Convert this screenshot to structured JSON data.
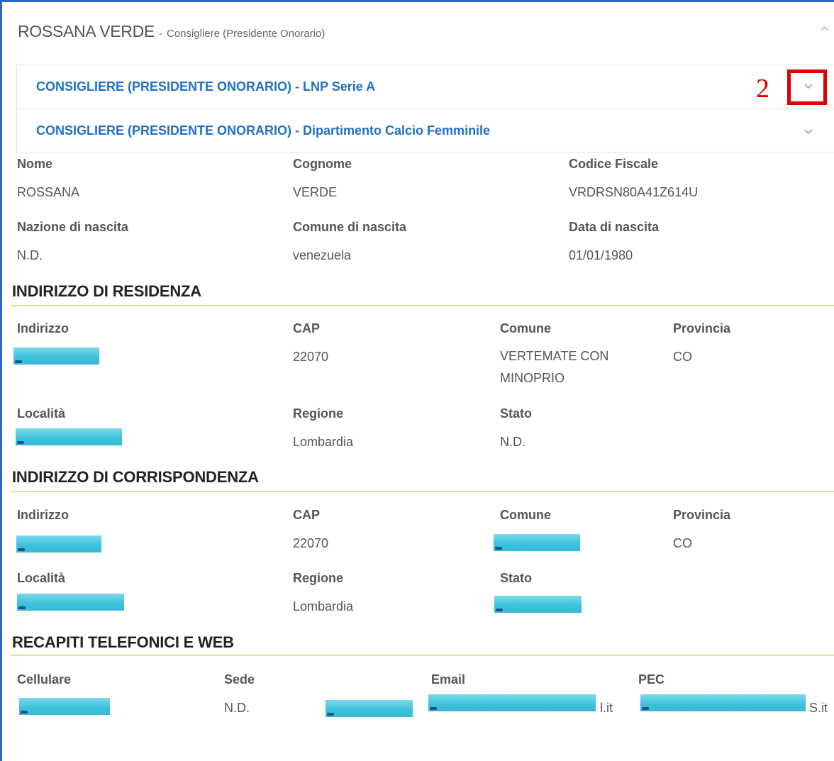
{
  "header": {
    "name": "ROSSANA VERDE",
    "separator": "-",
    "role": "Consigliere (Presidente Onorario)"
  },
  "accordion": [
    {
      "title": "CONSIGLIERE (PRESIDENTE ONORARIO) - LNP Serie A"
    },
    {
      "title": "CONSIGLIERE (PRESIDENTE ONORARIO) - Dipartimento Calcio Femminile"
    }
  ],
  "callout": {
    "number": "2",
    "color": "#e00000"
  },
  "personal": {
    "nome_label": "Nome",
    "nome": "ROSSANA",
    "cognome_label": "Cognome",
    "cognome": "VERDE",
    "cf_label": "Codice Fiscale",
    "cf": "VRDRSN80A41Z614U",
    "nazione_label": "Nazione di nascita",
    "nazione": "N.D.",
    "comune_label": "Comune di nascita",
    "comune": "venezuela",
    "data_label": "Data di nascita",
    "data": "01/01/1980"
  },
  "residenza": {
    "title": "INDIRIZZO DI RESIDENZA",
    "indirizzo_label": "Indirizzo",
    "cap_label": "CAP",
    "cap": "22070",
    "comune_label": "Comune",
    "comune": "VERTEMATE CON MINOPRIO",
    "provincia_label": "Provincia",
    "provincia": "CO",
    "localita_label": "Località",
    "regione_label": "Regione",
    "regione": "Lombardia",
    "stato_label": "Stato",
    "stato": "N.D."
  },
  "corrispondenza": {
    "title": "INDIRIZZO DI CORRISPONDENZA",
    "indirizzo_label": "Indirizzo",
    "cap_label": "CAP",
    "cap": "22070",
    "comune_label": "Comune",
    "provincia_label": "Provincia",
    "provincia": "CO",
    "localita_label": "Località",
    "regione_label": "Regione",
    "regione": "Lombardia",
    "stato_label": "Stato"
  },
  "recapiti": {
    "title": "RECAPITI TELEFONICI E WEB",
    "cellulare_label": "Cellulare",
    "sede_label": "Sede",
    "sede": "N.D.",
    "email_label": "Email",
    "email_suffix": "l.it",
    "pec_label": "PEC",
    "pec_suffix": "S.it"
  },
  "colors": {
    "accent_blue": "#1f6fc4",
    "frame_blue": "#2b66c9",
    "section_rule": "#f0d99a",
    "redaction": "#3ec3dd"
  },
  "icons": {
    "header_toggle": "chevron-up-icon",
    "accordion_toggle": "chevron-down-icon"
  }
}
